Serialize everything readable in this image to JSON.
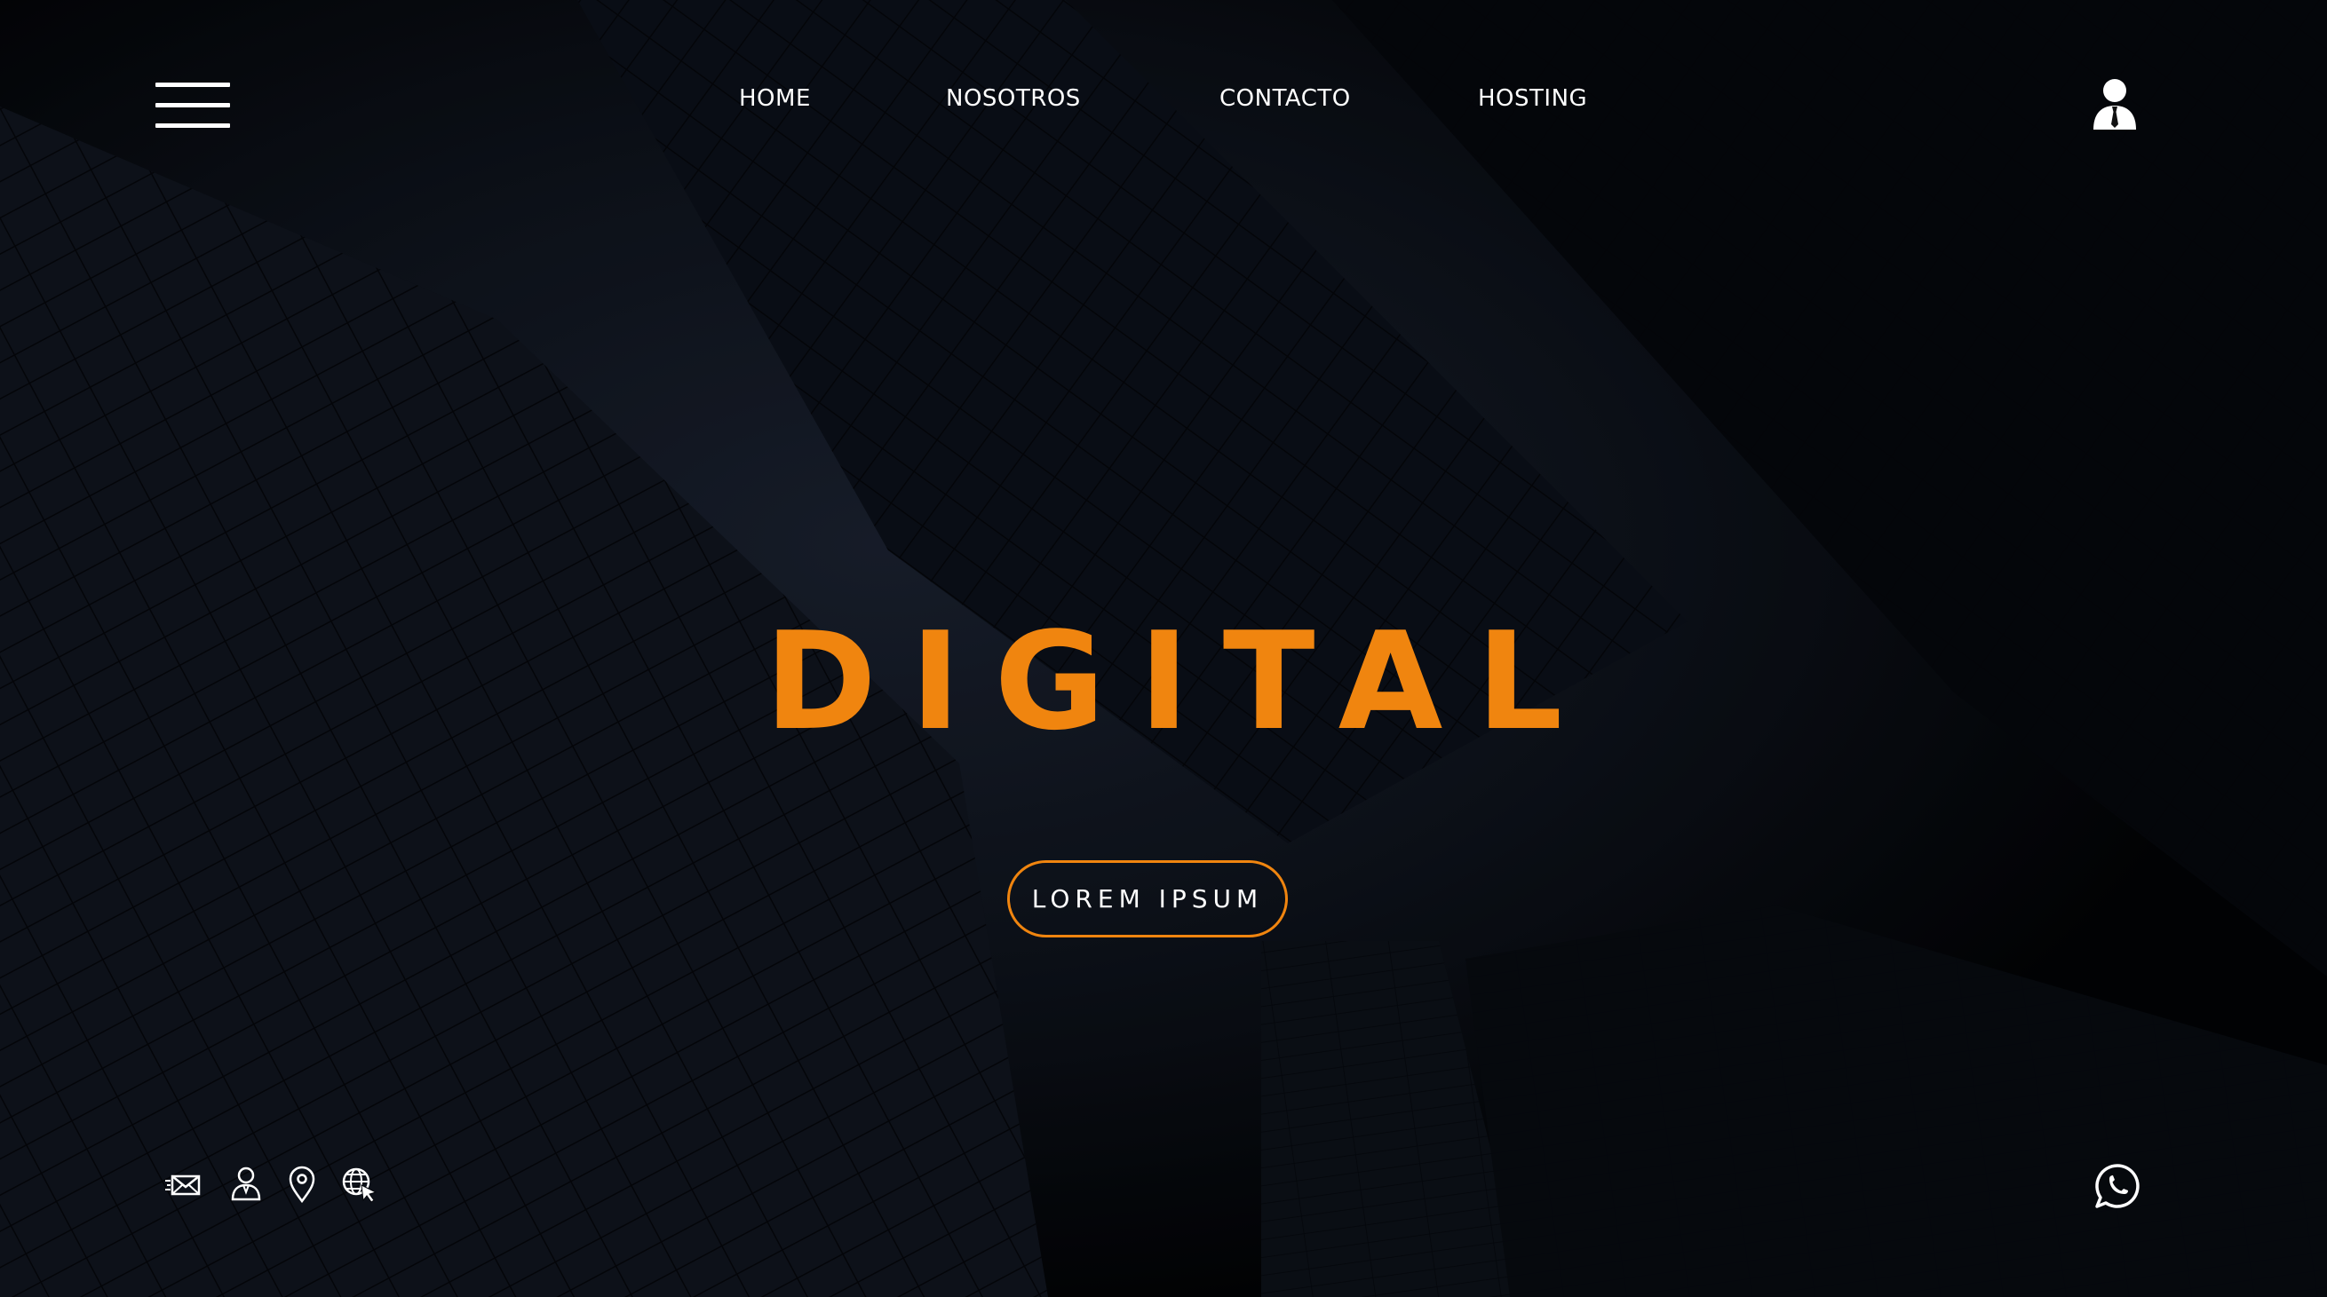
{
  "colors": {
    "accent": "#f0850f",
    "background": "#05070c",
    "text": "#ffffff"
  },
  "header": {
    "menu_icon": "hamburger-icon",
    "nav": [
      {
        "label": "HOME"
      },
      {
        "label": "NOSOTROS"
      },
      {
        "label": "CONTACTO"
      },
      {
        "label": "HOSTING"
      }
    ],
    "user_icon": "user-icon"
  },
  "hero": {
    "title": "DIGITAL",
    "cta_label": "LOREM IPSUM"
  },
  "footer": {
    "icons": [
      "email-icon",
      "person-icon",
      "location-pin-icon",
      "globe-cursor-icon"
    ],
    "chat_icon": "whatsapp-icon"
  }
}
